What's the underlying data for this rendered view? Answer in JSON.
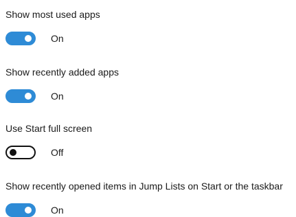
{
  "settings": [
    {
      "label": "Show most used apps",
      "state": "On",
      "on": true
    },
    {
      "label": "Show recently added apps",
      "state": "On",
      "on": true
    },
    {
      "label": "Use Start full screen",
      "state": "Off",
      "on": false
    },
    {
      "label": "Show recently opened items in Jump Lists on Start or the taskbar",
      "state": "On",
      "on": true
    }
  ],
  "colors": {
    "accent": "#2e8bd6",
    "off_border": "#111111",
    "text": "#1a1a1a"
  }
}
